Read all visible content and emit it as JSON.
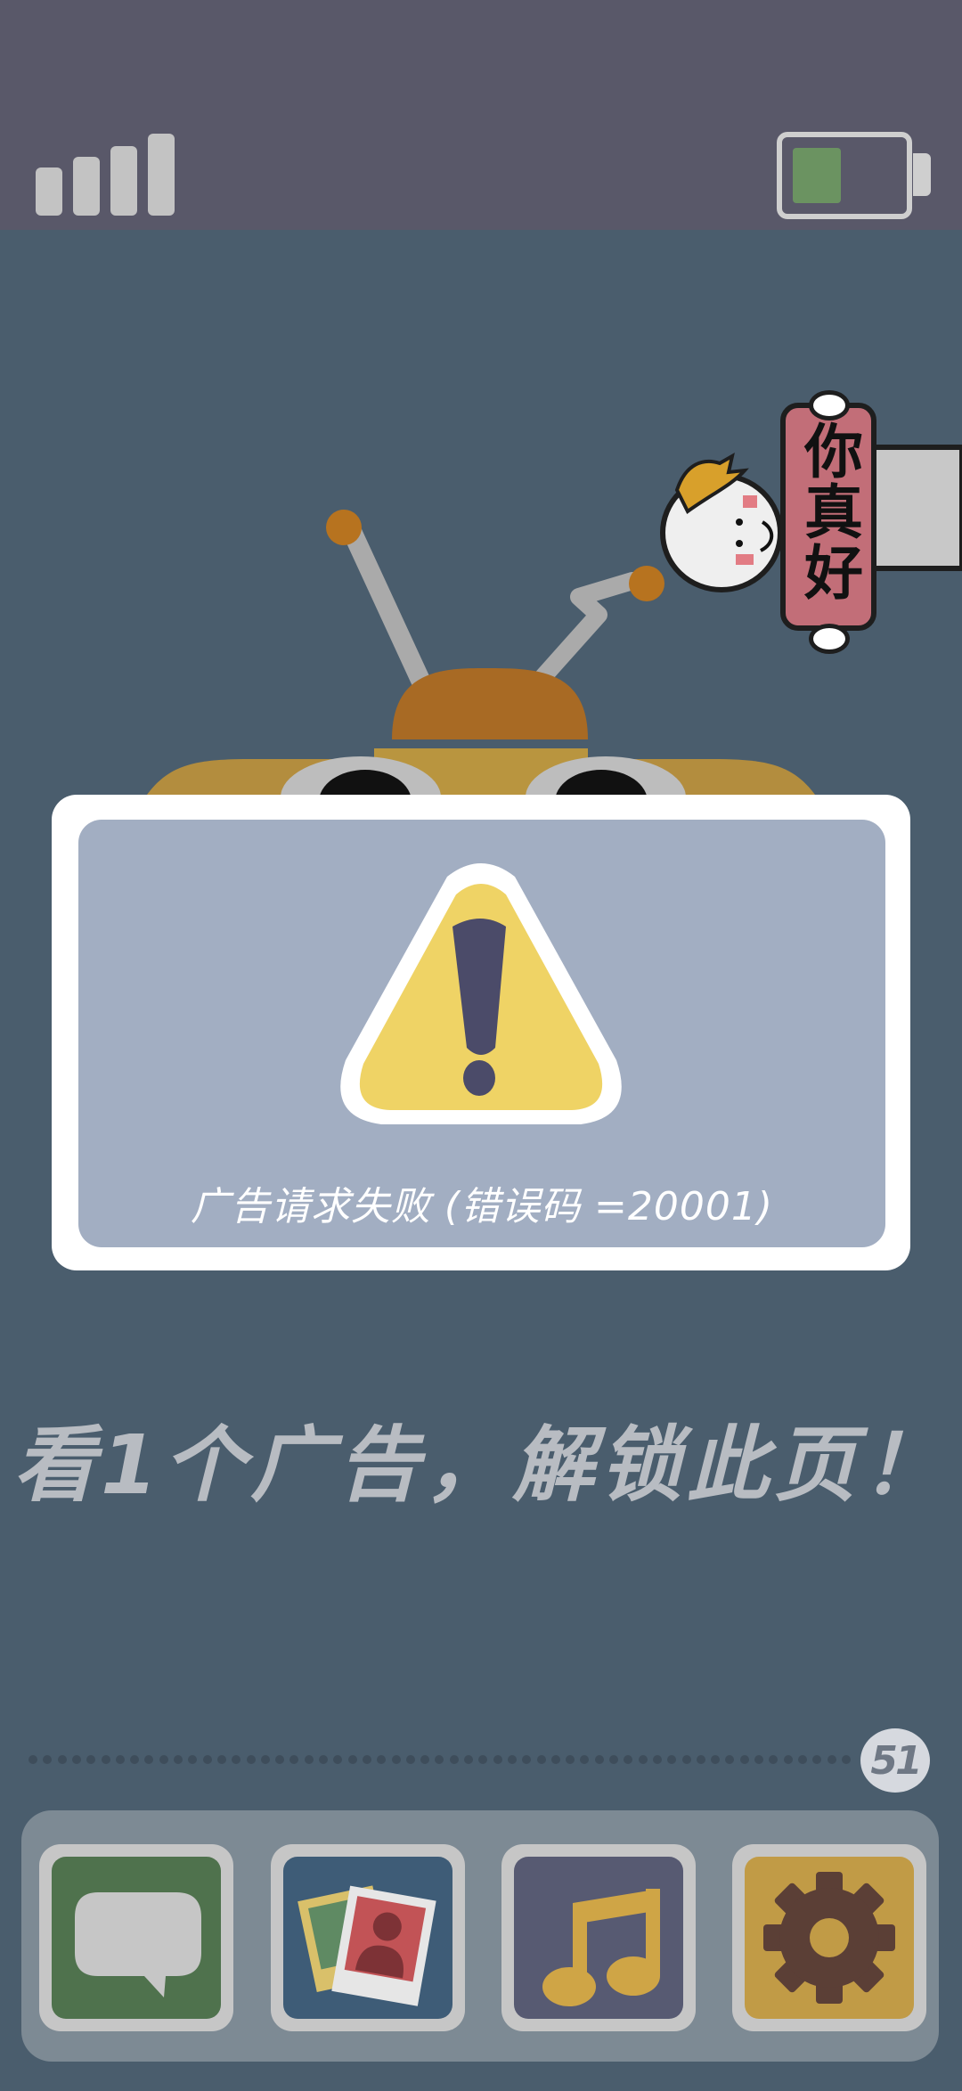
{
  "status_bar": {
    "signal_bars": 4,
    "battery_level": 0.4
  },
  "character": {
    "sign_text": "你真好"
  },
  "dialog": {
    "message": "广告请求失败 (错误码 =20001)"
  },
  "prompt": {
    "text": "看1个广告，解锁此页！"
  },
  "pager": {
    "current_page": "51"
  },
  "dock": {
    "apps": [
      {
        "name": "messages",
        "icon": "speech-bubble-icon",
        "color": "#4f724d"
      },
      {
        "name": "photos",
        "icon": "photo-icon",
        "color": "#3e5c77"
      },
      {
        "name": "music",
        "icon": "music-note-icon",
        "color": "#575a72"
      },
      {
        "name": "settings",
        "icon": "gear-icon",
        "color": "#c19b46"
      }
    ]
  },
  "colors": {
    "background": "#4a5d6d",
    "status_bar": "#595869",
    "dialog_panel": "#a2aec2",
    "warning_yellow": "#efd365",
    "sign": "#c26e78"
  }
}
